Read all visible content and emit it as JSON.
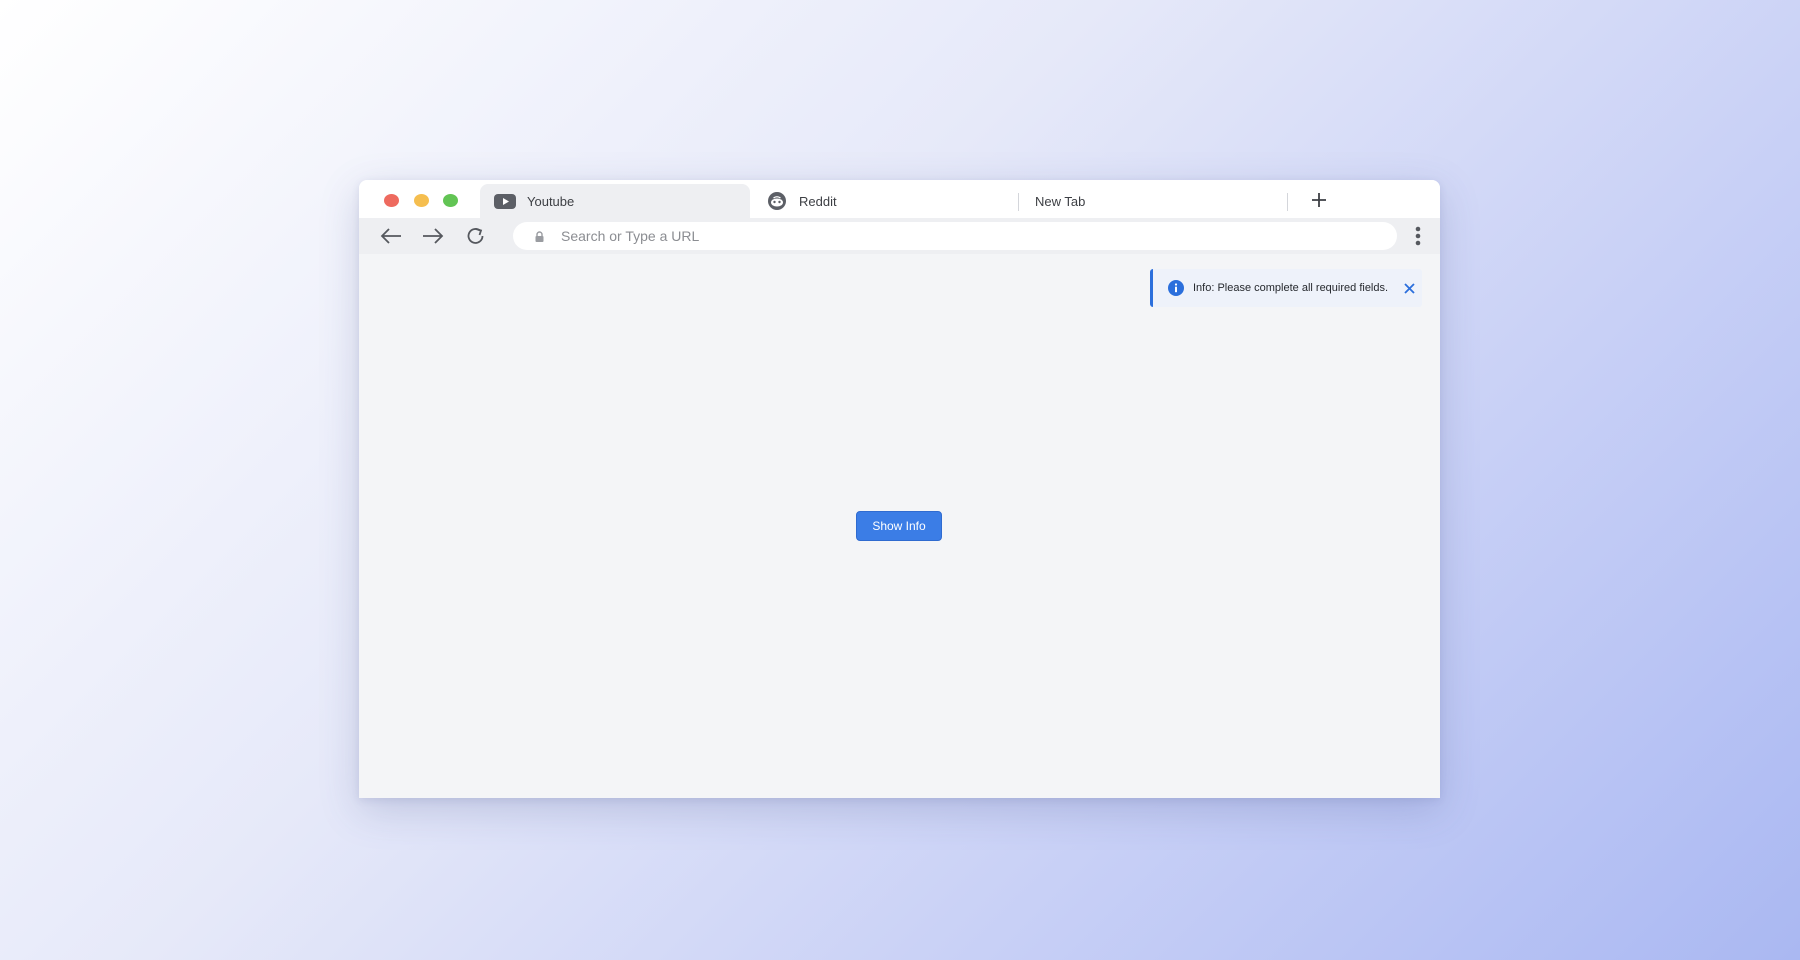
{
  "browser": {
    "tabs": [
      {
        "label": "Youtube",
        "icon": "youtube-icon",
        "active": true
      },
      {
        "label": "Reddit",
        "icon": "reddit-icon",
        "active": false
      },
      {
        "label": "New Tab",
        "icon": "",
        "active": false
      }
    ],
    "address_bar": {
      "placeholder": "Search or Type a URL",
      "value": ""
    }
  },
  "notification": {
    "message": "Info: Please complete all required fields.",
    "icon": "info-icon",
    "accent_color": "#2b6fdc"
  },
  "main": {
    "show_button_label": "Show Info",
    "button_color": "#3b7de6"
  }
}
